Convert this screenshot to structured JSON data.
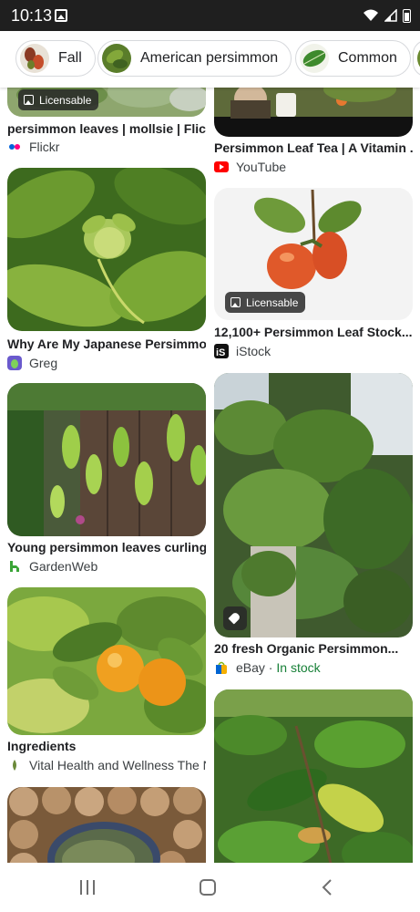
{
  "status_bar": {
    "time": "10:13"
  },
  "chips": [
    {
      "label": "Fall"
    },
    {
      "label": "American persimmon"
    },
    {
      "label": "Common"
    }
  ],
  "results": [
    {
      "title": "persimmon leaves | mollsie | Flickr",
      "source": "Flickr",
      "badge": "Licensable"
    },
    {
      "title": "Persimmon Leaf Tea | A Vitamin ...",
      "source": "YouTube"
    },
    {
      "title": "Why Are My Japanese Persimmo...",
      "source": "Greg"
    },
    {
      "title": "12,100+ Persimmon Leaf Stock...",
      "source": "iStock",
      "badge": "Licensable"
    },
    {
      "title": "Young persimmon leaves curling...",
      "source": "GardenWeb"
    },
    {
      "title": "20 fresh Organic Persimmon...",
      "source": "eBay",
      "availability": "In stock"
    },
    {
      "title": "Ingredients",
      "source": "Vital Health and Wellness The N"
    }
  ],
  "colors": {
    "youtube": "#ff0000",
    "gardenweb": "#3aa537",
    "in_stock": "#188038"
  }
}
